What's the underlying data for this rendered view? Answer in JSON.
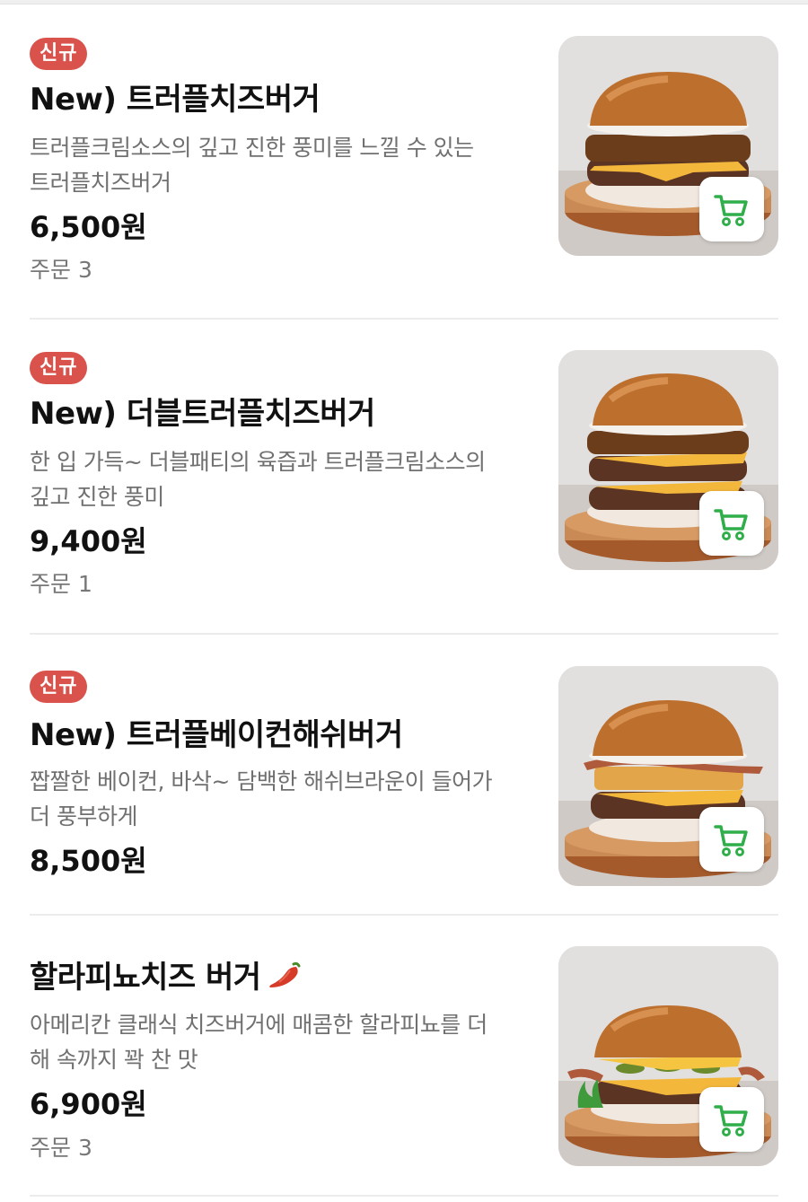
{
  "menu": {
    "items": [
      {
        "badge": "신규",
        "name": "New) 트러플치즈버거",
        "description_lines": [
          "트러플크림소스의 깊고 진한 풍미를 느낄 수 있는",
          "트러플치즈버거"
        ],
        "price": "6,500원",
        "orders": "주문 3",
        "image_icon": "burger-photo",
        "cart_icon": "cart-icon"
      },
      {
        "badge": "신규",
        "name": "New) 더블트러플치즈버거",
        "description_lines": [
          "한 입 가득~ 더블패티의 육즙과 트러플크림소스의",
          "깊고 진한 풍미"
        ],
        "price": "9,400원",
        "orders": "주문 1",
        "image_icon": "burger-photo",
        "cart_icon": "cart-icon"
      },
      {
        "badge": "신규",
        "name": "New) 트러플베이컨해쉬버거",
        "description_lines": [
          "짭짤한 베이컨, 바삭~ 담백한 해쉬브라운이 들어가",
          "더 풍부하게"
        ],
        "price": "8,500원",
        "image_icon": "burger-photo",
        "cart_icon": "cart-icon"
      },
      {
        "name": "할라피뇨치즈 버거",
        "name_icon": "chili-pepper-icon",
        "description_lines": [
          "아메리칸 클래식 치즈버거에 매콤한 할라피뇨를 더",
          "해 속까지 꽉 찬 맛"
        ],
        "price": "6,900원",
        "orders": "주문 3",
        "image_icon": "burger-photo",
        "cart_icon": "cart-icon"
      }
    ]
  },
  "colors": {
    "badge": "#d9534c",
    "cart": "#2fae4a",
    "text_primary": "#111111",
    "text_secondary": "#707070",
    "divider": "#ececec"
  }
}
